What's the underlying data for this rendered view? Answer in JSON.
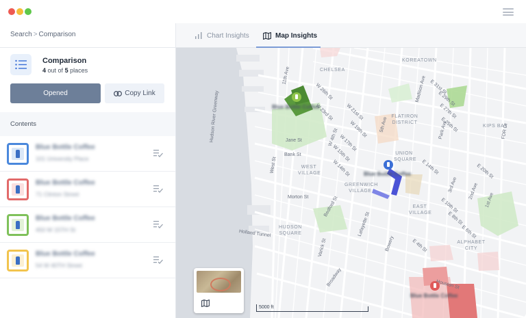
{
  "window": {
    "menu_icon": "hamburger-icon"
  },
  "sidebar": {
    "breadcrumb": {
      "root": "Search",
      "separator": ">",
      "current": "Comparison"
    },
    "comparison": {
      "icon": "list-icon",
      "title": "Comparison",
      "count": "4",
      "count_mid": "out of",
      "total": "5",
      "count_tail": "places"
    },
    "buttons": {
      "opened": "Opened",
      "copy_link": "Copy Link",
      "copy_link_icon": "link-icon"
    },
    "contents_label": "Contents",
    "items": [
      {
        "title": "Blue Bottle Coffee",
        "address": "101 University Place",
        "color": "#4a88dc"
      },
      {
        "title": "Blue Bottle Coffee",
        "address": "71 Clinton Street",
        "color": "#e26a6a"
      },
      {
        "title": "Blue Bottle Coffee",
        "address": "450 W 15TH St",
        "color": "#7fc15a"
      },
      {
        "title": "Blue Bottle Coffee",
        "address": "54 W 40TH Street",
        "color": "#f2c44e"
      }
    ]
  },
  "tabs": [
    {
      "label": "Chart Insights",
      "icon": "bar-chart-icon",
      "active": false
    },
    {
      "label": "Map Insights",
      "icon": "map-icon",
      "active": true
    }
  ],
  "map": {
    "districts": [
      "KOREATOWN",
      "CHELSEA",
      "FLATIRON DISTRICT",
      "UNION SQUARE",
      "WEST VILLAGE",
      "GREENWICH VILLAGE",
      "EAST VILLAGE",
      "HUDSON SQUARE",
      "ALPHABET CITY",
      "KIPS BAY"
    ],
    "streets": [
      "11th Ave",
      "W 26th St",
      "W 23rd St",
      "W 21st St",
      "W 19th St",
      "W 17th St",
      "W 15th St",
      "W 14th St",
      "Jane St",
      "Bank St",
      "Morton St",
      "W 4th St",
      "Bedford St",
      "Varick St",
      "Lafayette St",
      "Bowery",
      "E 31st St",
      "E 29th St",
      "E 27th St",
      "E 25th St",
      "E 14th St",
      "E 10th St",
      "E 8th St",
      "E 6th St",
      "E 4th St",
      "Houston St",
      "Hudson River Greenway",
      "Holland Tunnel",
      "West St",
      "Broadway",
      "5th Ave",
      "1st Ave",
      "2nd Ave",
      "3rd Ave",
      "Madison Ave",
      "Park Ave",
      "E 20th St",
      "FDR Dr"
    ],
    "pins": [
      {
        "label": "Blue Bottle Coffee",
        "color": "#5a9a3e"
      },
      {
        "label": "Blue Bottle Coffee",
        "color": "#3b6fd6"
      },
      {
        "label": "Blue Bottle Coffee",
        "color": "#e05a5a"
      }
    ],
    "scale_label": "5000 ft",
    "minimap_icon": "map-icon"
  }
}
